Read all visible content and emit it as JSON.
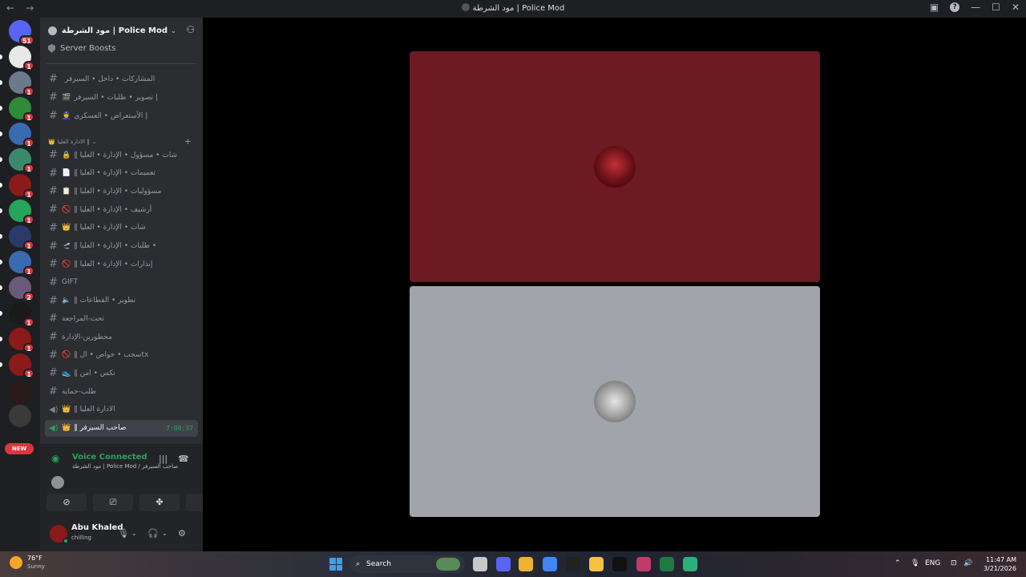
{
  "window": {
    "title": "مود الشرطة | Police Mod",
    "back": "←",
    "forward": "→"
  },
  "rail": {
    "servers": [
      {
        "name": "home",
        "badge": "51",
        "color": "#5865f2"
      },
      {
        "name": "server-1",
        "badge": "1",
        "color": "#e8e8e8"
      },
      {
        "name": "server-2",
        "badge": "1",
        "color": "#6a7a8a"
      },
      {
        "name": "server-3",
        "badge": "1",
        "color": "#2f8a3a"
      },
      {
        "name": "server-4",
        "badge": "1",
        "color": "#3a6ab0"
      },
      {
        "name": "server-5",
        "badge": "1",
        "color": "#3a8a6a"
      },
      {
        "name": "server-6",
        "badge": "1",
        "color": "#8b1a1a"
      },
      {
        "name": "server-7",
        "badge": "1",
        "color": "#23a55a"
      },
      {
        "name": "server-8",
        "badge": "1",
        "color": "#2a3a6a"
      },
      {
        "name": "server-9",
        "badge": "1",
        "color": "#3a6ab0"
      },
      {
        "name": "server-10",
        "badge": "2",
        "color": "#6a5a7a"
      },
      {
        "name": "server-11",
        "badge": "1",
        "color": "#1a1a1a"
      },
      {
        "name": "server-12",
        "badge": "1",
        "color": "#8b1a1a"
      },
      {
        "name": "server-13",
        "badge": "1",
        "color": "#8b1a1a"
      },
      {
        "name": "server-14",
        "badge": "",
        "color": "#2a1a1a"
      },
      {
        "name": "server-15",
        "badge": "",
        "color": "#3a3a3a"
      }
    ],
    "new_label": "NEW"
  },
  "server": {
    "name": "مود الشرطة | Police Mod",
    "boosts": "Server Boosts"
  },
  "channels_top": [
    {
      "label": "المشاركات • داخل • السيرفر",
      "emoji": ""
    },
    {
      "label": "تصوير • طلبات • السيرفر |",
      "emoji": "🎬"
    },
    {
      "label": "الأستعراض • العسكري |",
      "emoji": "👮"
    }
  ],
  "category": {
    "label": "الادارة العليا ‖",
    "emoji": "👑"
  },
  "channels": [
    {
      "label": "‖ شات • مسؤول • الإدارة • العليا",
      "emoji": "🔒",
      "type": "text"
    },
    {
      "label": "‖ تعميمات • الإدارة • العليا",
      "emoji": "📄",
      "type": "text"
    },
    {
      "label": "‖ مسؤوليات • الإدارة • العليا",
      "emoji": "📋",
      "type": "text"
    },
    {
      "label": "‖ أرشيف • الإدارة • العليا",
      "emoji": "🚫",
      "type": "text"
    },
    {
      "label": "‖ شات • الإدارة • العليا",
      "emoji": "👑",
      "type": "text"
    },
    {
      "label": "‖ طلبات • الإدارة • العليا •",
      "emoji": "🛫",
      "type": "text"
    },
    {
      "label": "‖ إنذارات • الإدارة • العليا",
      "emoji": "🚫",
      "type": "text"
    },
    {
      "label": "GIFT",
      "emoji": "",
      "type": "text"
    },
    {
      "label": "‖ تطوير • القطاعات",
      "emoji": "🔈",
      "type": "text"
    },
    {
      "label": "تحت-المراجعة",
      "emoji": "",
      "type": "text"
    },
    {
      "label": "محظورين-الإدارة",
      "emoji": "",
      "type": "text"
    },
    {
      "label": "‖ سحب • خواص • الtx",
      "emoji": "🚫",
      "type": "text"
    },
    {
      "label": "‖ نكس • امن",
      "emoji": "👟",
      "type": "text"
    },
    {
      "label": "طلب-حماية",
      "emoji": "",
      "type": "text"
    },
    {
      "label": "‖ الادارة العليا",
      "emoji": "👑",
      "type": "voice"
    },
    {
      "label": "‖ صاحب السيرفر",
      "emoji": "👑",
      "type": "voice",
      "active": true,
      "timer": "7:00:37"
    }
  ],
  "voice": {
    "title": "Voice Connected",
    "sub": "مود الشرطة | Police Mod / صاحب السيرفر",
    "buttons": [
      {
        "name": "camera-off",
        "glyph": "⊘"
      },
      {
        "name": "screen-share",
        "glyph": "⎚"
      },
      {
        "name": "activities",
        "glyph": "✤"
      },
      {
        "name": "soundboard",
        "glyph": "♫"
      }
    ]
  },
  "user": {
    "name": "Abu Khaled",
    "status": "chilling"
  },
  "taskbar": {
    "temp": "76°F",
    "condition": "Sunny",
    "search": "Search",
    "lang": "ENG",
    "time": "11:47 AM",
    "date": "3/21/2026",
    "apps": [
      {
        "name": "file-explorer-app",
        "color": "#c8c8c8"
      },
      {
        "name": "discord-app",
        "color": "#5865f2"
      },
      {
        "name": "discord-canary-app",
        "color": "#f0b232"
      },
      {
        "name": "chrome-app",
        "color": "#4285f4"
      },
      {
        "name": "ctrl-app",
        "color": "#222222"
      },
      {
        "name": "folder-app",
        "color": "#f5c342"
      },
      {
        "name": "tiktok-app",
        "color": "#111111"
      },
      {
        "name": "browser-app",
        "color": "#c03a6a"
      },
      {
        "name": "excel-app",
        "color": "#1f7a44"
      },
      {
        "name": "game-app",
        "color": "#2ab07a"
      }
    ]
  },
  "colors": {
    "red_tile": "#6e1a22",
    "gray_tile": "#a1a4ab",
    "accent_green": "#23a55a",
    "badge_red": "#da373c"
  }
}
